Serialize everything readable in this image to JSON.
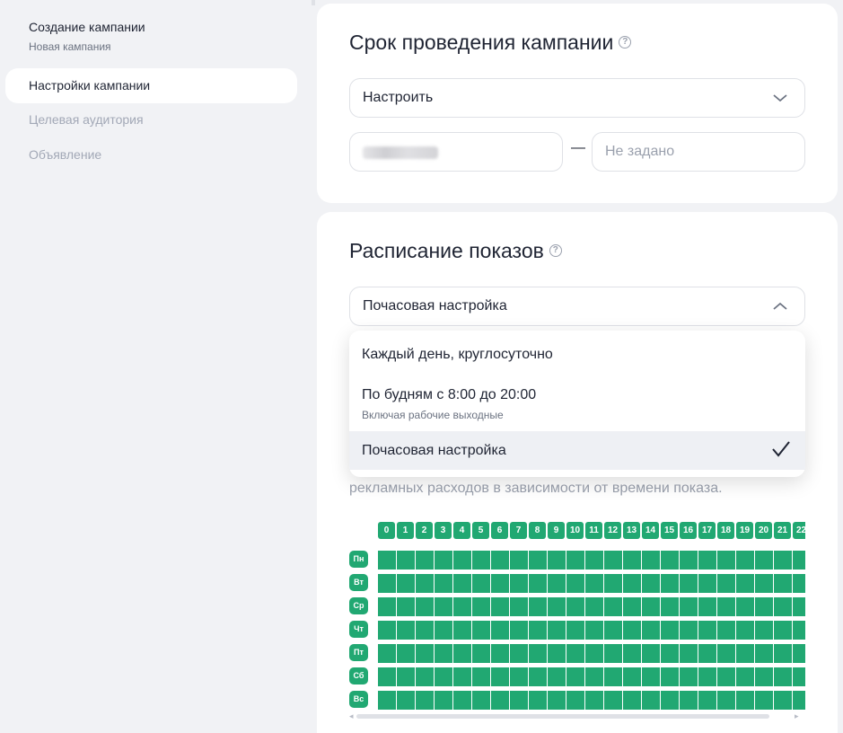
{
  "sidebar": {
    "title": "Создание кампании",
    "subtitle": "Новая кампания",
    "items": [
      {
        "label": "Настройки кампании",
        "active": true
      },
      {
        "label": "Целевая аудитория",
        "active": false
      },
      {
        "label": "Объявление",
        "active": false
      }
    ]
  },
  "period_card": {
    "title": "Срок проведения кампании",
    "select_value": "Настроить",
    "date_to_placeholder": "Не задано",
    "dash": "—"
  },
  "schedule_card": {
    "title": "Расписание показов",
    "select_value": "Почасовая настройка",
    "description_tail": "рекламных расходов в зависимости от времени показа.",
    "dropdown_options": [
      {
        "label": "Каждый день, круглосуточно",
        "sub": ""
      },
      {
        "label": "По будням с 8:00 до 20:00",
        "sub": "Включая рабочие выходные"
      },
      {
        "label": "Почасовая настройка",
        "sub": "",
        "selected": true
      }
    ],
    "hours": [
      "0",
      "1",
      "2",
      "3",
      "4",
      "5",
      "6",
      "7",
      "8",
      "9",
      "10",
      "11",
      "12",
      "13",
      "14",
      "15",
      "16",
      "17",
      "18",
      "19",
      "20",
      "21",
      "22"
    ],
    "days": [
      "Пн",
      "Вт",
      "Ср",
      "Чт",
      "Пт",
      "Сб",
      "Вс"
    ]
  },
  "colors": {
    "accent_green": "#21a872",
    "background": "#f1f2f5",
    "card": "#ffffff"
  }
}
